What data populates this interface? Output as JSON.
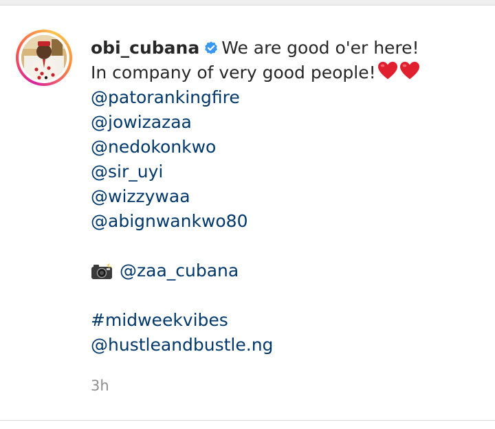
{
  "post": {
    "username": "obi_cubana",
    "caption_first": "We are good o'er here!",
    "caption_second": "In company of very good people!",
    "mentions": [
      "@patorankingfire",
      "@jowizazaa",
      "@nedokonkwo",
      "@sir_uyi",
      "@wizzywaa",
      "@abignwankwo80"
    ],
    "photo_credit": "@zaa_cubana",
    "hashtag": "#midweekvibes",
    "last_mention": "@hustleandbustle.ng",
    "timestamp": "3h",
    "icons": {
      "verified": "verified-badge-icon",
      "heart": "red-heart-icon",
      "camera": "camera-with-flash-icon"
    },
    "colors": {
      "link": "#00376b",
      "text": "#262626",
      "verified": "#3897f0",
      "heart": "#e0202e",
      "timestamp": "#8e8e8e"
    }
  }
}
